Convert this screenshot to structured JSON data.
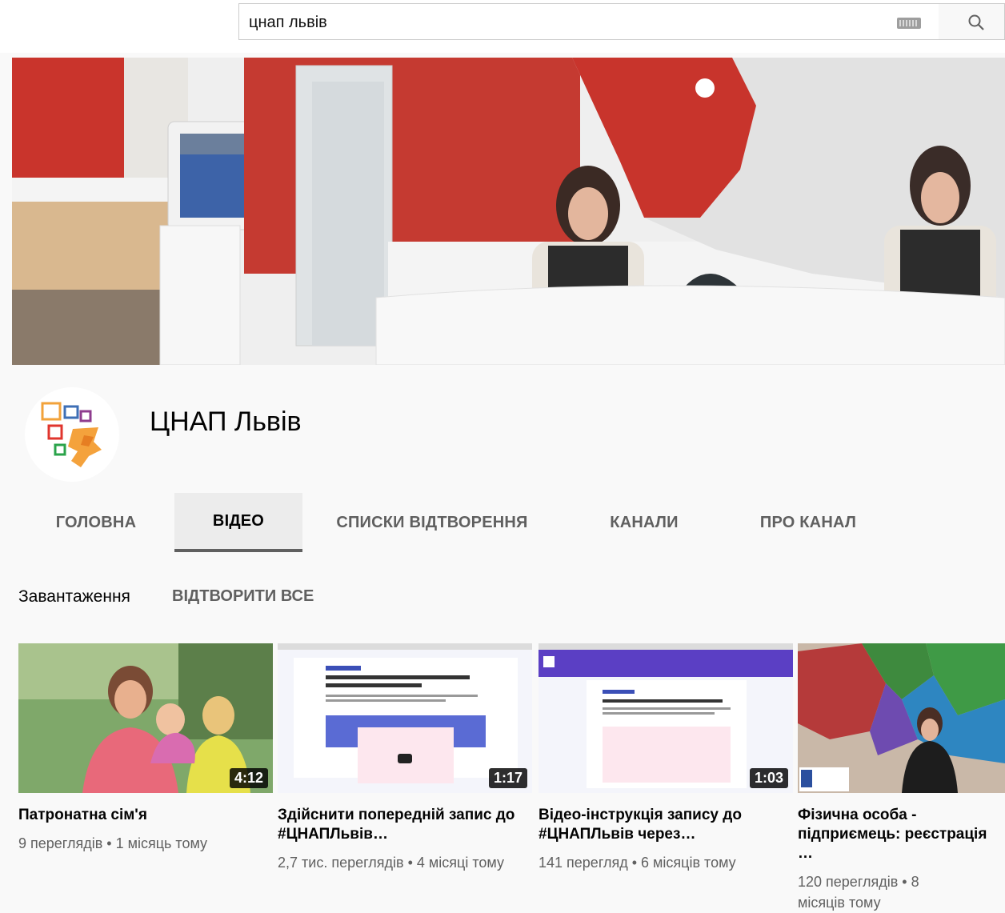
{
  "search": {
    "query": "цнап львів"
  },
  "channel": {
    "name": "ЦНАП Львів"
  },
  "tabs": [
    {
      "label": "ГОЛОВНА"
    },
    {
      "label": "ВІДЕО"
    },
    {
      "label": "СПИСКИ ВІДТВОРЕННЯ"
    },
    {
      "label": "КАНАЛИ"
    },
    {
      "label": "ПРО КАНАЛ"
    }
  ],
  "active_tab": "ВІДЕО",
  "section": {
    "title": "Завантаження",
    "play_all": "ВІДТВОРИТИ ВСЕ"
  },
  "videos": [
    {
      "duration": "4:12",
      "title": "Патронатна сім'я",
      "views": "9 переглядів",
      "age": "1 місяць тому",
      "meta": "9 переглядів • 1 місяць тому"
    },
    {
      "duration": "1:17",
      "title": "Здійснити попередній запис до #ЦНАПЛьвів…",
      "views": "2,7 тис. переглядів",
      "age": "4 місяці тому",
      "meta": "2,7 тис. переглядів • 4 місяці тому"
    },
    {
      "duration": "1:03",
      "title": "Відео-інструкція запису до #ЦНАПЛьвів через…",
      "views": "141 перегляд",
      "age": "6 місяців тому",
      "meta": "141 перегляд • 6 місяців тому"
    },
    {
      "duration": "",
      "title": "Фізична особа - підприємець: реєстрація …",
      "views": "120 переглядів",
      "age": "8 місяців тому",
      "meta": "120 переглядів • 8 місяців тому"
    }
  ],
  "colors": {
    "accent_red": "#c62828",
    "text_secondary": "#606060",
    "background": "#f9f9f9"
  }
}
